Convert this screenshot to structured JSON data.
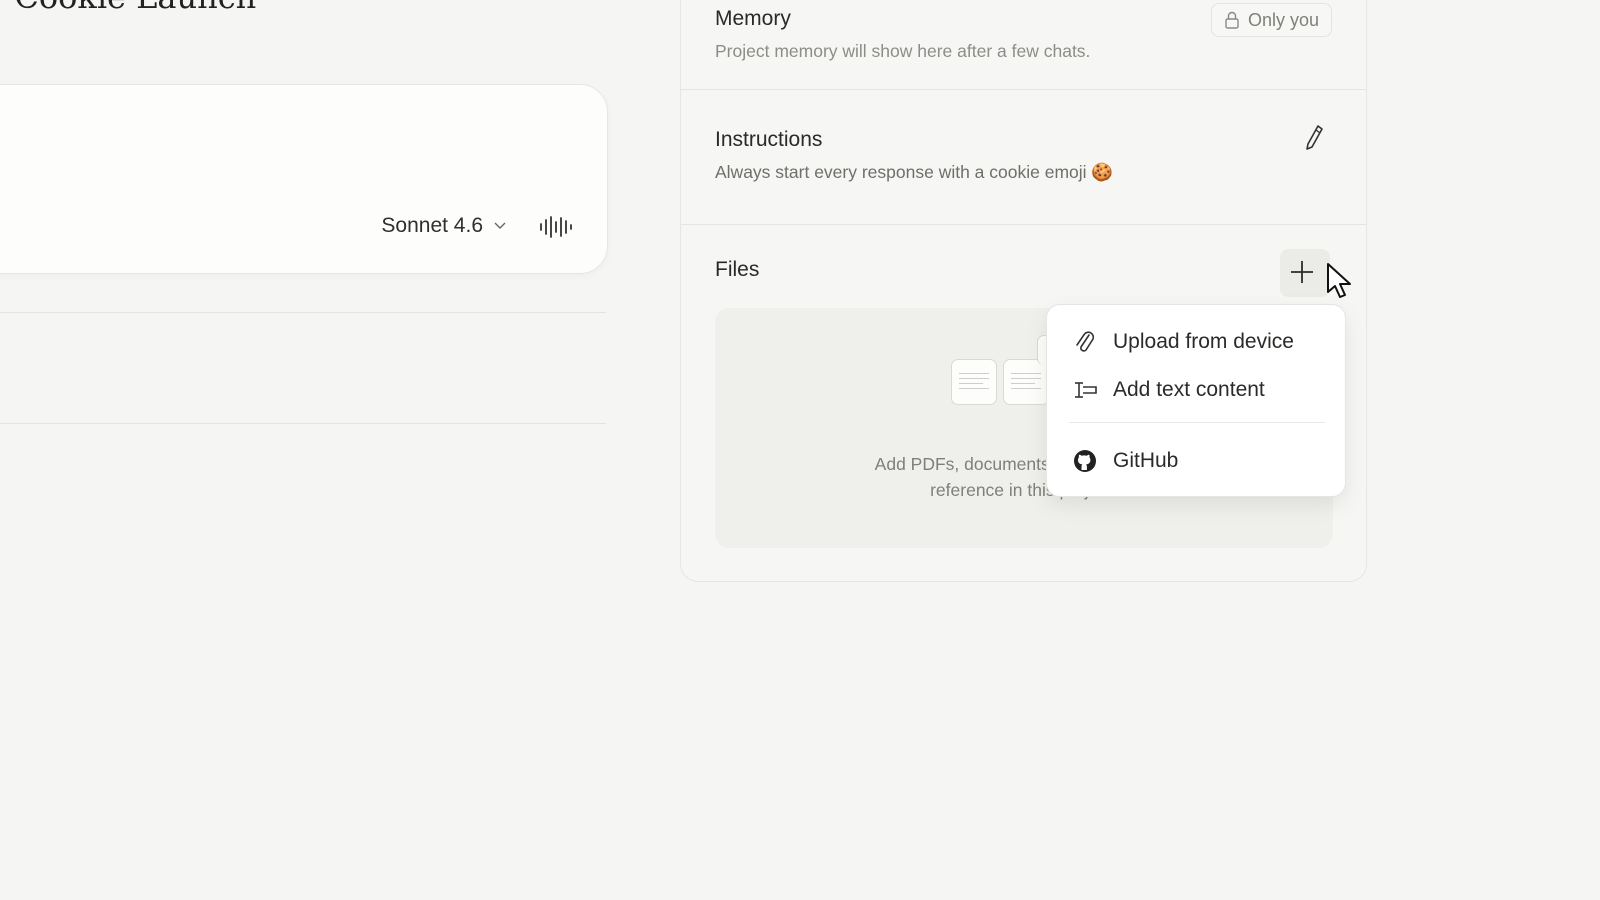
{
  "project": {
    "title": "er Cookie Launch"
  },
  "composer": {
    "model_name": "Sonnet 4.6"
  },
  "panel": {
    "memory": {
      "title": "Memory",
      "visibility": "Only you",
      "description": "Project memory will show here after a few chats."
    },
    "instructions": {
      "title": "Instructions",
      "text": "Always start every response with a cookie emoji 🍪"
    },
    "files": {
      "title": "Files",
      "empty_line1": "Add PDFs, documents, or other text to",
      "empty_line2": "reference in this project."
    }
  },
  "add_menu": {
    "items": [
      {
        "label": "Upload from device",
        "icon": "paperclip-icon"
      },
      {
        "label": "Add text content",
        "icon": "text-input-icon"
      },
      {
        "label": "GitHub",
        "icon": "github-icon"
      }
    ]
  },
  "colors": {
    "background": "#f5f5f3",
    "card": "#fdfdfc",
    "border": "#e6e6e2",
    "muted_text": "#8d8d88"
  }
}
